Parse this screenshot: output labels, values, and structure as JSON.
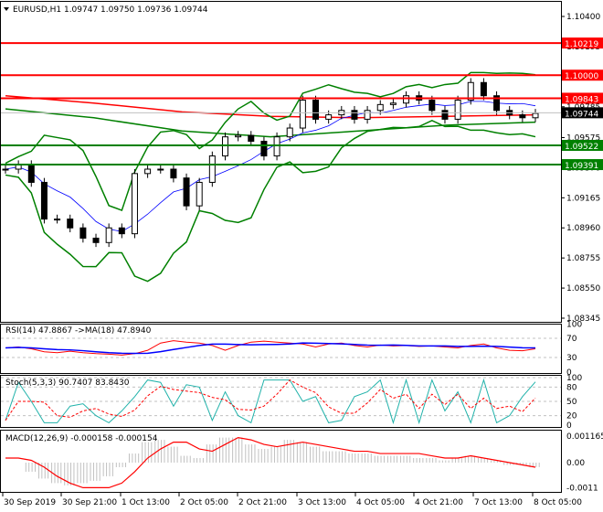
{
  "header": {
    "symbol": "EURUSD,H1",
    "ohlc": "1.09747 1.09750 1.09736 1.09744"
  },
  "indicators": {
    "rsi_label": "RSI(14) 47.8867  ->MA(18) 47.8940",
    "stoch_label": "Stoch(5,3,3) 90.7407 83.8430",
    "macd_label": "MACD(12,26,9) -0.000158 -0.000154"
  },
  "colors": {
    "resistance": "#ff0000",
    "support": "#008000",
    "bollinger": "#008000",
    "rsi": "#ff0000",
    "rsi_ma": "#0000ff",
    "stoch_main": "#20b2aa",
    "stoch_signal": "#ff0000",
    "macd_hist": "#c0c0c0",
    "macd_signal": "#ff0000",
    "current_price_tag": "#000000"
  },
  "chart_data": [
    {
      "type": "candlestick",
      "symbol": "EURUSD",
      "timeframe": "H1",
      "ylim": [
        1.08345,
        1.104
      ],
      "price_ticks": [
        "1.10400",
        "1.10195",
        "1.09985",
        "1.09785",
        "1.09575",
        "1.09370",
        "1.09165",
        "1.08960",
        "1.08755",
        "1.08550",
        "1.08345"
      ],
      "time_ticks": [
        "30 Sep 2019",
        "30 Sep 21:00",
        "1 Oct 13:00",
        "2 Oct 05:00",
        "2 Oct 21:00",
        "3 Oct 13:00",
        "4 Oct 05:00",
        "4 Oct 21:00",
        "7 Oct 13:00",
        "8 Oct 05:00"
      ],
      "closes": [
        1.0936,
        1.0939,
        1.0927,
        1.0902,
        1.0902,
        1.0896,
        1.0889,
        1.0886,
        1.0896,
        1.0892,
        1.0933,
        1.0936,
        1.0936,
        1.093,
        1.0911,
        1.0927,
        1.0945,
        1.0958,
        1.0959,
        1.0955,
        1.0945,
        1.0958,
        1.0964,
        1.0983,
        1.097,
        1.0973,
        1.0976,
        1.097,
        1.0976,
        1.098,
        1.0981,
        1.0986,
        1.0983,
        1.0976,
        1.097,
        1.0983,
        1.0995,
        1.0986,
        1.0976,
        1.0973,
        1.0971,
        1.0974
      ],
      "horizontal_levels": [
        {
          "price": "1.10219",
          "kind": "resistance"
        },
        {
          "price": "1.10000",
          "kind": "resistance"
        },
        {
          "price": "1.09843",
          "kind": "resistance"
        },
        {
          "price": "1.09522",
          "kind": "support"
        },
        {
          "price": "1.09391",
          "kind": "support"
        }
      ],
      "current_price": "1.09744",
      "slow_ma_red": [
        1.0986,
        1.0981,
        1.0975,
        1.0972,
        1.0971,
        1.0972,
        1.0973
      ],
      "slow_ma_green": [
        1.0977,
        1.0971,
        1.0962,
        1.0958,
        1.0962,
        1.0966,
        1.0968
      ]
    },
    {
      "type": "line",
      "name": "RSI",
      "ylim": [
        0,
        100
      ],
      "levels": [
        30,
        70
      ],
      "ticks": [
        "100",
        "70",
        "30",
        "0"
      ],
      "values": [
        50,
        52,
        48,
        42,
        40,
        43,
        40,
        38,
        37,
        35,
        38,
        45,
        60,
        65,
        62,
        60,
        55,
        45,
        55,
        62,
        64,
        62,
        60,
        58,
        52,
        58,
        60,
        55,
        52,
        56,
        54,
        55,
        53,
        54,
        52,
        50,
        55,
        58,
        50,
        45,
        44,
        48
      ]
    },
    {
      "type": "line",
      "name": "Stochastic",
      "ylim": [
        0,
        100
      ],
      "levels": [
        20,
        50,
        80
      ],
      "ticks": [
        "100",
        "80",
        "50",
        "20",
        "0"
      ],
      "values": [
        10,
        90,
        50,
        5,
        5,
        40,
        45,
        20,
        5,
        30,
        60,
        95,
        90,
        40,
        85,
        80,
        10,
        70,
        20,
        5,
        95,
        95,
        95,
        50,
        60,
        5,
        10,
        60,
        70,
        95,
        5,
        95,
        5,
        95,
        30,
        70,
        5,
        95,
        5,
        20,
        60,
        91
      ]
    },
    {
      "type": "bar+line",
      "name": "MACD",
      "ylim": [
        -0.0012,
        0.0013
      ],
      "ticks": [
        "0.001165",
        "0.00",
        "-0.0011"
      ],
      "histogram": [
        0.0,
        0.0,
        -0.0004,
        -0.0007,
        -0.0009,
        -0.001,
        -0.0009,
        -0.0008,
        -0.0006,
        -0.0002,
        0.0004,
        0.0009,
        0.001,
        0.0007,
        0.0003,
        0.0002,
        0.0008,
        0.0011,
        0.0011,
        0.0008,
        0.0006,
        0.0007,
        0.001,
        0.0009,
        0.0007,
        0.0005,
        0.0005,
        0.0004,
        0.0004,
        0.0003,
        0.0003,
        0.0003,
        0.0002,
        0.0002,
        0.0001,
        0.0002,
        0.0003,
        0.0002,
        0.0001,
        -0.0001,
        -0.0001,
        -0.0002
      ],
      "signal": [
        0.0002,
        0.0002,
        0.0001,
        -0.0002,
        -0.0006,
        -0.0009,
        -0.0011,
        -0.0011,
        -0.0011,
        -0.0009,
        -0.0004,
        0.0002,
        0.0006,
        0.0009,
        0.0009,
        0.0006,
        0.0005,
        0.0008,
        0.0011,
        0.001,
        0.0008,
        0.0007,
        0.0008,
        0.0009,
        0.0008,
        0.0007,
        0.0006,
        0.0005,
        0.0005,
        0.0004,
        0.0004,
        0.0004,
        0.0004,
        0.0003,
        0.0002,
        0.0002,
        0.0003,
        0.0002,
        0.0001,
        0.0,
        -0.0001,
        -0.0002
      ]
    }
  ]
}
